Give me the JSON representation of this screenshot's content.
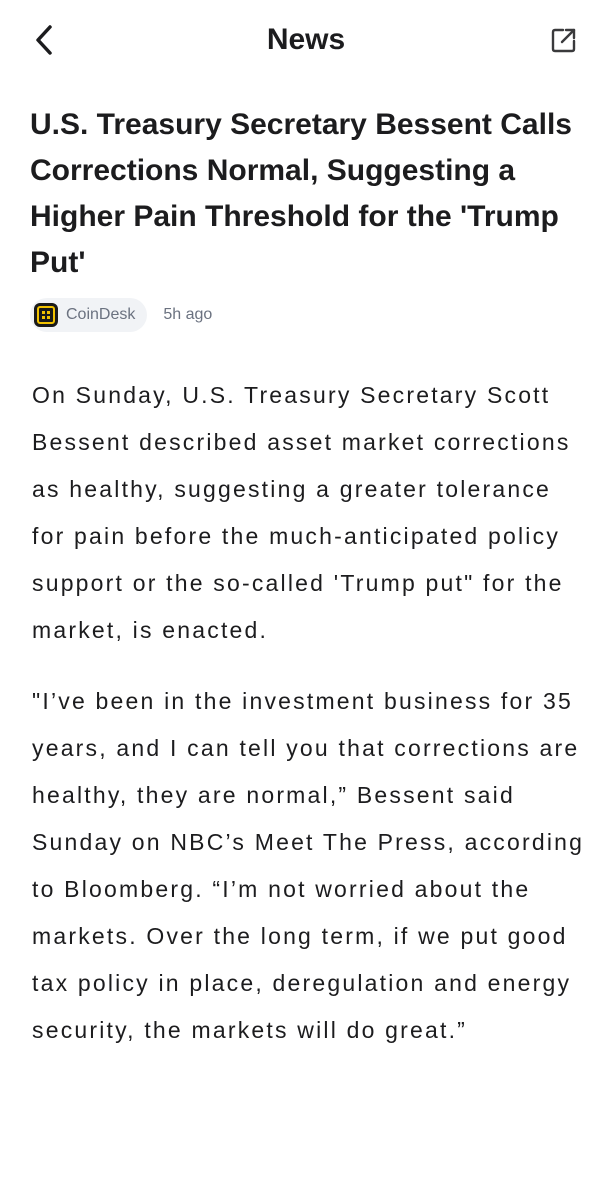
{
  "header": {
    "title": "News",
    "back_icon": "chevron-left-icon",
    "share_icon": "share-icon"
  },
  "article": {
    "title": "U.S. Treasury Secretary Bessent Calls Corrections Normal, Suggesting a Higher Pain Threshold for the 'Trump Put'",
    "source": "CoinDesk",
    "source_icon": "coindesk-logo-icon",
    "time": "5h ago",
    "paragraphs": [
      "On Sunday, U.S. Treasury Secretary Scott Bessent described asset market corrections as healthy, suggesting a greater tolerance for pain before the much-anticipated policy support or the so-called 'Trump put\" for the market, is enacted.",
      "\"I’ve been in the investment business for 35 years, and I can tell you that corrections are healthy, they are normal,” Bessent said Sunday on NBC’s Meet The Press, according to Bloomberg. “I’m not worried about the markets. Over the long term, if we put good tax policy in place, deregulation and energy security, the markets will do great.”"
    ]
  },
  "colors": {
    "text": "#1c1c1e",
    "meta_text": "#6b7280",
    "chip_background": "#f1f3f6",
    "logo_accent": "#f2c200"
  }
}
